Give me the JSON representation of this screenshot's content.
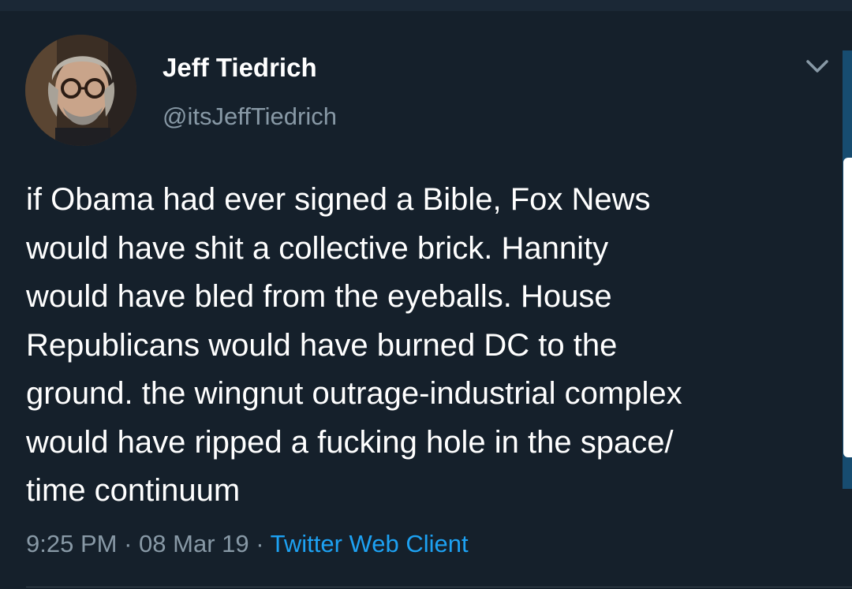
{
  "tweet": {
    "author": {
      "display_name": "Jeff Tiedrich",
      "handle": "@itsJeffTiedrich"
    },
    "text_lines": [
      "if Obama had ever signed a Bible, Fox News",
      "would have shit a collective brick. Hannity",
      "would have bled from the eyeballs. House",
      "Republicans would have burned DC to the",
      "ground. the wingnut outrage-industrial complex",
      "would have ripped a fucking hole in the space/",
      "time continuum"
    ],
    "time": "9:25 PM",
    "separator": "·",
    "date": "08 Mar 19",
    "source": "Twitter Web Client"
  },
  "icons": {
    "menu": "chevron-down-icon"
  },
  "colors": {
    "background": "#15202b",
    "text": "#ffffff",
    "secondary_text": "#8899a6",
    "link": "#1da1f2"
  }
}
